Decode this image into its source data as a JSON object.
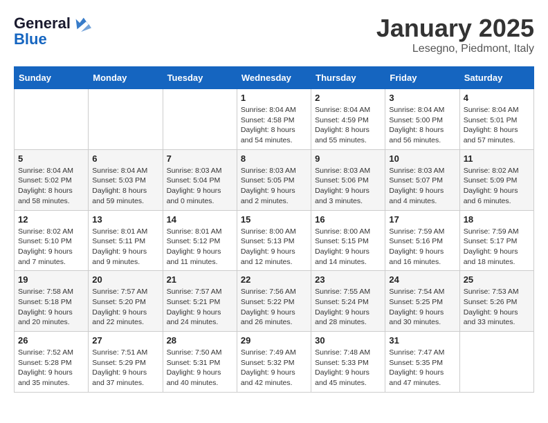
{
  "header": {
    "logo_line1": "General",
    "logo_line2": "Blue",
    "month": "January 2025",
    "location": "Lesegno, Piedmont, Italy"
  },
  "days_of_week": [
    "Sunday",
    "Monday",
    "Tuesday",
    "Wednesday",
    "Thursday",
    "Friday",
    "Saturday"
  ],
  "weeks": [
    [
      {
        "day": "",
        "info": ""
      },
      {
        "day": "",
        "info": ""
      },
      {
        "day": "",
        "info": ""
      },
      {
        "day": "1",
        "info": "Sunrise: 8:04 AM\nSunset: 4:58 PM\nDaylight: 8 hours\nand 54 minutes."
      },
      {
        "day": "2",
        "info": "Sunrise: 8:04 AM\nSunset: 4:59 PM\nDaylight: 8 hours\nand 55 minutes."
      },
      {
        "day": "3",
        "info": "Sunrise: 8:04 AM\nSunset: 5:00 PM\nDaylight: 8 hours\nand 56 minutes."
      },
      {
        "day": "4",
        "info": "Sunrise: 8:04 AM\nSunset: 5:01 PM\nDaylight: 8 hours\nand 57 minutes."
      }
    ],
    [
      {
        "day": "5",
        "info": "Sunrise: 8:04 AM\nSunset: 5:02 PM\nDaylight: 8 hours\nand 58 minutes."
      },
      {
        "day": "6",
        "info": "Sunrise: 8:04 AM\nSunset: 5:03 PM\nDaylight: 8 hours\nand 59 minutes."
      },
      {
        "day": "7",
        "info": "Sunrise: 8:03 AM\nSunset: 5:04 PM\nDaylight: 9 hours\nand 0 minutes."
      },
      {
        "day": "8",
        "info": "Sunrise: 8:03 AM\nSunset: 5:05 PM\nDaylight: 9 hours\nand 2 minutes."
      },
      {
        "day": "9",
        "info": "Sunrise: 8:03 AM\nSunset: 5:06 PM\nDaylight: 9 hours\nand 3 minutes."
      },
      {
        "day": "10",
        "info": "Sunrise: 8:03 AM\nSunset: 5:07 PM\nDaylight: 9 hours\nand 4 minutes."
      },
      {
        "day": "11",
        "info": "Sunrise: 8:02 AM\nSunset: 5:09 PM\nDaylight: 9 hours\nand 6 minutes."
      }
    ],
    [
      {
        "day": "12",
        "info": "Sunrise: 8:02 AM\nSunset: 5:10 PM\nDaylight: 9 hours\nand 7 minutes."
      },
      {
        "day": "13",
        "info": "Sunrise: 8:01 AM\nSunset: 5:11 PM\nDaylight: 9 hours\nand 9 minutes."
      },
      {
        "day": "14",
        "info": "Sunrise: 8:01 AM\nSunset: 5:12 PM\nDaylight: 9 hours\nand 11 minutes."
      },
      {
        "day": "15",
        "info": "Sunrise: 8:00 AM\nSunset: 5:13 PM\nDaylight: 9 hours\nand 12 minutes."
      },
      {
        "day": "16",
        "info": "Sunrise: 8:00 AM\nSunset: 5:15 PM\nDaylight: 9 hours\nand 14 minutes."
      },
      {
        "day": "17",
        "info": "Sunrise: 7:59 AM\nSunset: 5:16 PM\nDaylight: 9 hours\nand 16 minutes."
      },
      {
        "day": "18",
        "info": "Sunrise: 7:59 AM\nSunset: 5:17 PM\nDaylight: 9 hours\nand 18 minutes."
      }
    ],
    [
      {
        "day": "19",
        "info": "Sunrise: 7:58 AM\nSunset: 5:18 PM\nDaylight: 9 hours\nand 20 minutes."
      },
      {
        "day": "20",
        "info": "Sunrise: 7:57 AM\nSunset: 5:20 PM\nDaylight: 9 hours\nand 22 minutes."
      },
      {
        "day": "21",
        "info": "Sunrise: 7:57 AM\nSunset: 5:21 PM\nDaylight: 9 hours\nand 24 minutes."
      },
      {
        "day": "22",
        "info": "Sunrise: 7:56 AM\nSunset: 5:22 PM\nDaylight: 9 hours\nand 26 minutes."
      },
      {
        "day": "23",
        "info": "Sunrise: 7:55 AM\nSunset: 5:24 PM\nDaylight: 9 hours\nand 28 minutes."
      },
      {
        "day": "24",
        "info": "Sunrise: 7:54 AM\nSunset: 5:25 PM\nDaylight: 9 hours\nand 30 minutes."
      },
      {
        "day": "25",
        "info": "Sunrise: 7:53 AM\nSunset: 5:26 PM\nDaylight: 9 hours\nand 33 minutes."
      }
    ],
    [
      {
        "day": "26",
        "info": "Sunrise: 7:52 AM\nSunset: 5:28 PM\nDaylight: 9 hours\nand 35 minutes."
      },
      {
        "day": "27",
        "info": "Sunrise: 7:51 AM\nSunset: 5:29 PM\nDaylight: 9 hours\nand 37 minutes."
      },
      {
        "day": "28",
        "info": "Sunrise: 7:50 AM\nSunset: 5:31 PM\nDaylight: 9 hours\nand 40 minutes."
      },
      {
        "day": "29",
        "info": "Sunrise: 7:49 AM\nSunset: 5:32 PM\nDaylight: 9 hours\nand 42 minutes."
      },
      {
        "day": "30",
        "info": "Sunrise: 7:48 AM\nSunset: 5:33 PM\nDaylight: 9 hours\nand 45 minutes."
      },
      {
        "day": "31",
        "info": "Sunrise: 7:47 AM\nSunset: 5:35 PM\nDaylight: 9 hours\nand 47 minutes."
      },
      {
        "day": "",
        "info": ""
      }
    ]
  ]
}
